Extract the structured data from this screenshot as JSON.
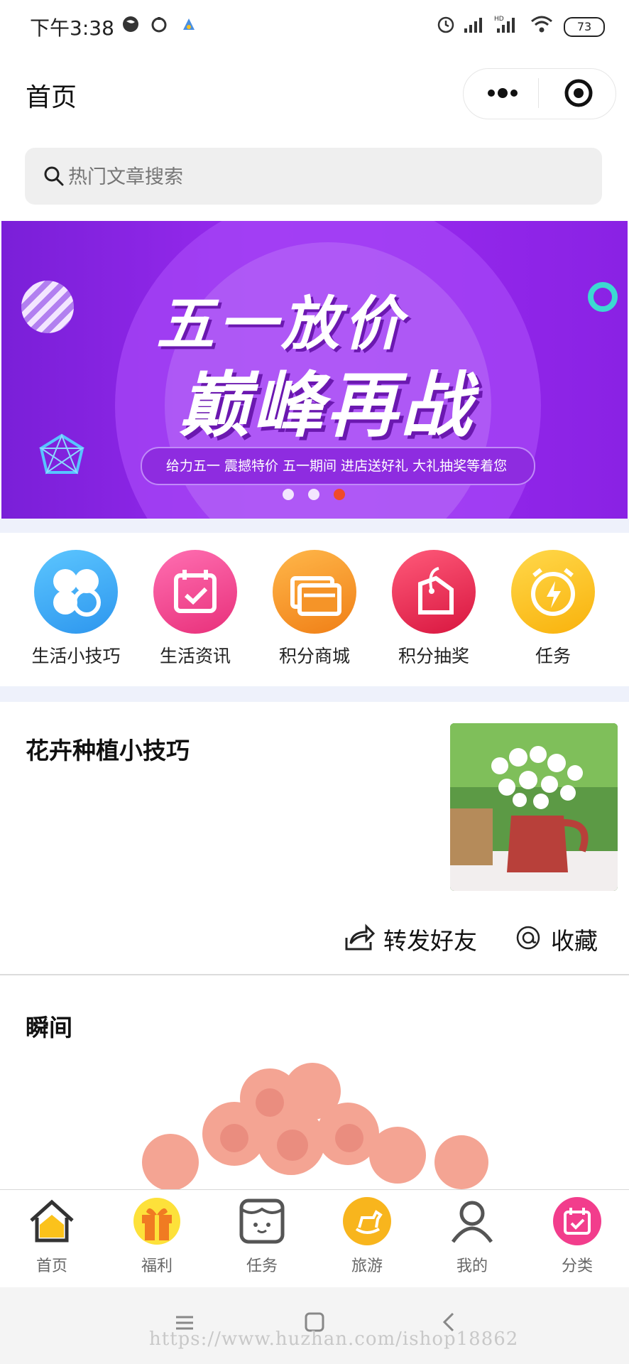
{
  "status_bar": {
    "time": "下午3:38",
    "battery": "73",
    "left_icons": [
      "globe-icon",
      "alarm-clock-icon",
      "app-notification-icon"
    ],
    "right_icons": [
      "alarm-icon",
      "signal-icon",
      "hd-signal-icon",
      "wifi-icon",
      "battery-icon"
    ]
  },
  "header": {
    "title": "首页",
    "capsule_icons": [
      "more-icon",
      "target-icon"
    ]
  },
  "search": {
    "placeholder": "热门文章搜索"
  },
  "banner": {
    "title_line1": "五一放价",
    "title_line2": "巅峰再战",
    "subtitle": "给力五一 震撼特价 五一期间 进店送好礼 大礼抽奖等着您",
    "slide_count": 3,
    "active_slide": 3,
    "colors": {
      "background": "#8a22e4",
      "accent_dot": "#f04a2a"
    }
  },
  "shortcuts": [
    {
      "label": "生活小技巧",
      "icon": "clover-icon",
      "color": "#3aaef2"
    },
    {
      "label": "生活资讯",
      "icon": "calendar-check-icon",
      "color": "#f0468f"
    },
    {
      "label": "积分商城",
      "icon": "cards-icon",
      "color": "#f79a24"
    },
    {
      "label": "积分抽奖",
      "icon": "tag-icon",
      "color": "#ea2a55"
    },
    {
      "label": "任务",
      "icon": "alarm-bolt-icon",
      "color": "#fdc21b"
    }
  ],
  "article": {
    "title": "花卉种植小技巧",
    "thumbnail": "flower-vase-photo",
    "share_label": "转发好友",
    "favorite_label": "收藏"
  },
  "moment": {
    "title": "瞬间",
    "image": "roses-photo"
  },
  "tabbar": [
    {
      "label": "首页",
      "icon": "home-icon"
    },
    {
      "label": "福利",
      "icon": "gift-icon"
    },
    {
      "label": "任务",
      "icon": "task-face-icon"
    },
    {
      "label": "旅游",
      "icon": "rocking-horse-icon"
    },
    {
      "label": "我的",
      "icon": "user-icon"
    },
    {
      "label": "分类",
      "icon": "calendar-icon"
    }
  ],
  "watermark": "https://www.huzhan.com/ishop18862"
}
